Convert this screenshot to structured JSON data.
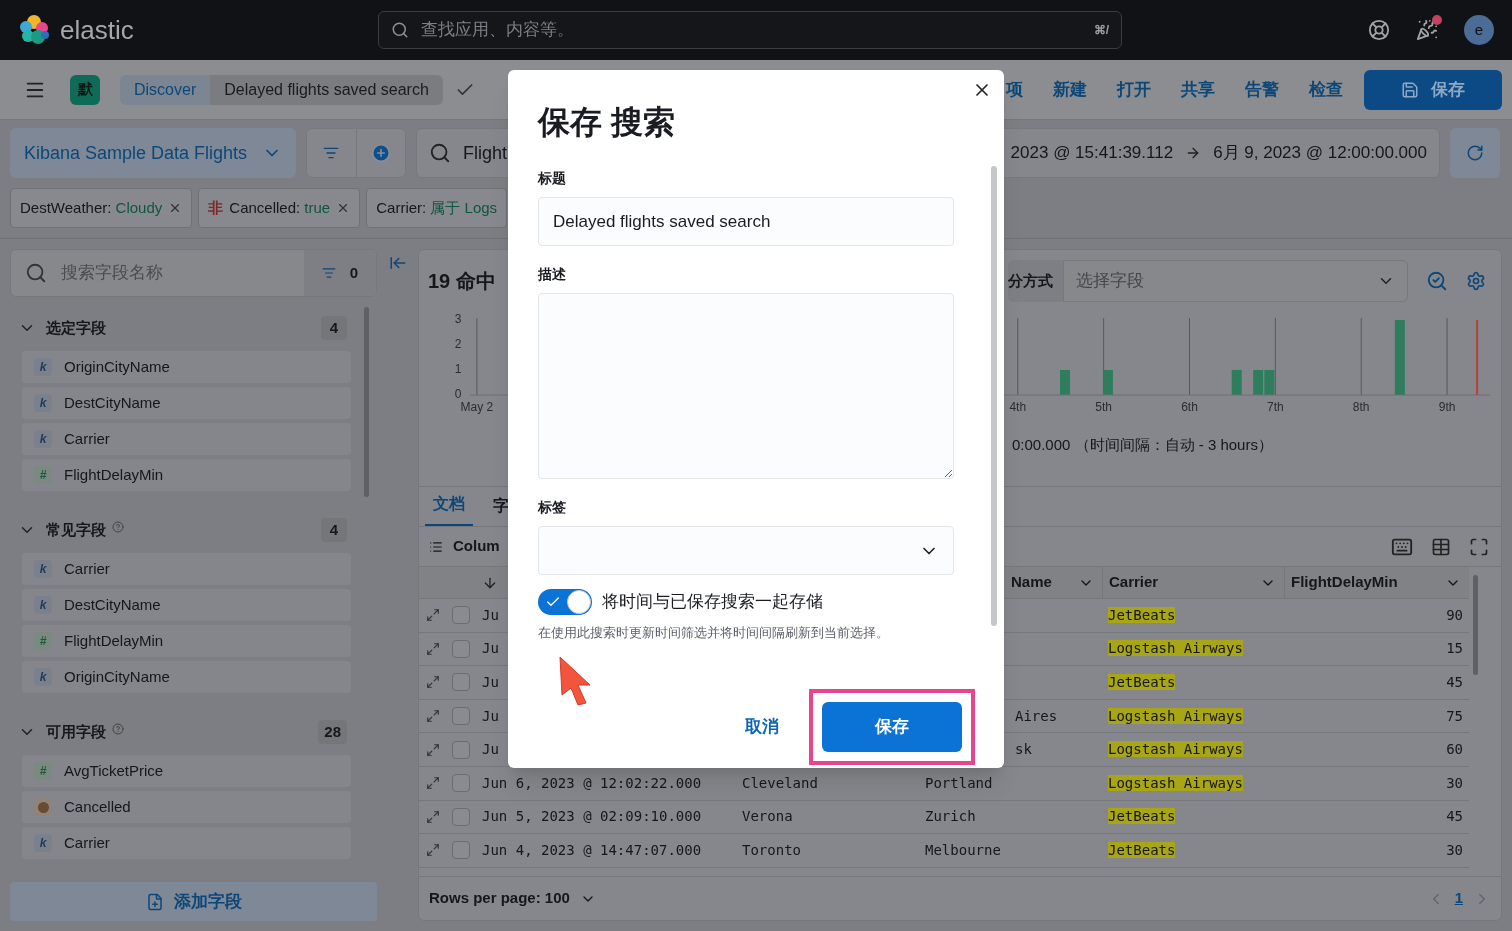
{
  "topbar": {
    "logo_text": "elastic",
    "search": {
      "placeholder": "查找应用、内容等。",
      "shortcut": "⌘/"
    },
    "news_unread": true,
    "avatar": "e"
  },
  "navbar": {
    "space_badge": "默",
    "breadcrumbs": [
      {
        "label": "Discover",
        "selected": false
      },
      {
        "label": "Delayed flights saved search",
        "selected": true
      }
    ],
    "menu": [
      "项",
      "新建",
      "打开",
      "共享",
      "告警",
      "检查"
    ],
    "save_button": "保存"
  },
  "query_bar": {
    "data_view": "Kibana Sample Data Flights",
    "query": "Flight",
    "time_start": "2023 @ 15:41:39.112",
    "time_end": "6月 9, 2023 @ 12:00:00.000"
  },
  "filters": [
    {
      "field": "DestWeather: ",
      "value": "Cloudy",
      "removable": true
    },
    {
      "negation": "非",
      "field": "Cancelled: ",
      "value": "true",
      "removable": true
    },
    {
      "field": "Carrier: ",
      "value": "属于 Logs",
      "removable": false
    }
  ],
  "sidebar": {
    "search_placeholder": "搜索字段名称",
    "filter_count": "0",
    "add_field_button": "添加字段",
    "sections": [
      {
        "title": "选定字段",
        "help": false,
        "count": "4",
        "expanded": true,
        "fields": [
          {
            "kind": "keyword",
            "glyph": "k",
            "name": "OriginCityName"
          },
          {
            "kind": "keyword",
            "glyph": "k",
            "name": "DestCityName"
          },
          {
            "kind": "keyword",
            "glyph": "k",
            "name": "Carrier"
          },
          {
            "kind": "number",
            "glyph": "#",
            "name": "FlightDelayMin"
          }
        ]
      },
      {
        "title": "常见字段",
        "help": true,
        "count": "4",
        "expanded": true,
        "fields": [
          {
            "kind": "keyword",
            "glyph": "k",
            "name": "Carrier"
          },
          {
            "kind": "keyword",
            "glyph": "k",
            "name": "DestCityName"
          },
          {
            "kind": "number",
            "glyph": "#",
            "name": "FlightDelayMin"
          },
          {
            "kind": "keyword",
            "glyph": "k",
            "name": "OriginCityName"
          }
        ]
      },
      {
        "title": "可用字段",
        "help": true,
        "count": "28",
        "expanded": true,
        "fields": [
          {
            "kind": "number",
            "glyph": "#",
            "name": "AvgTicketPrice"
          },
          {
            "kind": "boolean",
            "name": "Cancelled"
          },
          {
            "kind": "keyword",
            "glyph": "k",
            "name": "Carrier"
          }
        ]
      }
    ]
  },
  "histogram": {
    "hits": "19 命中",
    "breakdown_label": "分方式",
    "breakdown_placeholder": "选择字段",
    "interval_text": "0:00.000 （时间间隔：自动 - 3 hours）",
    "chart_data": {
      "type": "bar",
      "xlim": [
        -2.38,
        9.5
      ],
      "ylim": [
        0,
        3
      ],
      "yticks": [
        0,
        1,
        2,
        3
      ],
      "grid": true,
      "xticks": [
        {
          "value": -2.3,
          "label": "May 2"
        },
        {
          "value": 4,
          "label": "4th"
        },
        {
          "value": 5,
          "label": "5th"
        },
        {
          "value": 6,
          "label": "6th"
        },
        {
          "value": 7,
          "label": "7th"
        },
        {
          "value": 8,
          "label": "8th"
        },
        {
          "value": 9,
          "label": "9th"
        }
      ],
      "x": [
        4.55,
        5.05,
        6.55,
        6.8,
        6.93,
        8.45
      ],
      "values": [
        1,
        1,
        1,
        1,
        1,
        3
      ],
      "ref_lines": [
        {
          "axis": "x",
          "value": 9.35,
          "color": "#b5413a"
        }
      ]
    }
  },
  "tabs": [
    {
      "label": "文档",
      "selected": true
    },
    {
      "label": "字",
      "selected": false
    }
  ],
  "toolbar": {
    "columns_button": "Colum"
  },
  "table": {
    "columns": [
      {
        "label": "Name"
      },
      {
        "label": "Carrier"
      },
      {
        "label": "FlightDelayMin"
      }
    ],
    "rows": [
      {
        "kind": "partial",
        "checked": false,
        "timestamp": "Ju",
        "carrier": "JetBeats",
        "highlighted": true,
        "delay": "90"
      },
      {
        "kind": "partial",
        "checked": false,
        "timestamp": "Ju",
        "carrier": "Logstash Airways",
        "highlighted": true,
        "delay": "15"
      },
      {
        "kind": "partial",
        "checked": false,
        "timestamp": "Ju",
        "carrier": "JetBeats",
        "highlighted": true,
        "delay": "45"
      },
      {
        "kind": "partial",
        "checked": false,
        "timestamp": "Ju",
        "destination": "Aires",
        "carrier": "Logstash Airways",
        "highlighted": true,
        "delay": "75"
      },
      {
        "kind": "partial",
        "checked": false,
        "timestamp": "Ju",
        "destination": "sk",
        "carrier": "Logstash Airways",
        "highlighted": true,
        "delay": "60"
      },
      {
        "kind": "full",
        "checked": false,
        "timestamp": "Jun 6, 2023 @ 12:02:22.000",
        "origin": "Cleveland",
        "destination": "Portland",
        "carrier": "Logstash Airways",
        "highlighted": true,
        "delay": "30"
      },
      {
        "kind": "full",
        "checked": false,
        "timestamp": "Jun 5, 2023 @ 02:09:10.000",
        "origin": "Verona",
        "destination": "Zurich",
        "carrier": "JetBeats",
        "highlighted": true,
        "delay": "45"
      },
      {
        "kind": "full",
        "checked": false,
        "timestamp": "Jun 4, 2023 @ 14:47:07.000",
        "origin": "Toronto",
        "destination": "Melbourne",
        "carrier": "JetBeats",
        "highlighted": true,
        "delay": "30"
      }
    ]
  },
  "footer": {
    "rows_per_page": "Rows per page: 100",
    "pages": [
      {
        "label": "1",
        "selected": true
      }
    ]
  },
  "modal": {
    "title": "保存 搜索",
    "fields": [
      {
        "kind": "text",
        "label": "标题",
        "value": "Delayed flights saved search"
      },
      {
        "kind": "textarea",
        "label": "描述"
      },
      {
        "kind": "select",
        "label": "标签"
      }
    ],
    "toggle": {
      "label": "将时间与已保存搜索一起存储",
      "on": true,
      "help": "在使用此搜索时更新时间筛选并将时间间隔刷新到当前选择。"
    },
    "cancel": "取消",
    "confirm": "保存",
    "confirm_highlighted": true
  }
}
